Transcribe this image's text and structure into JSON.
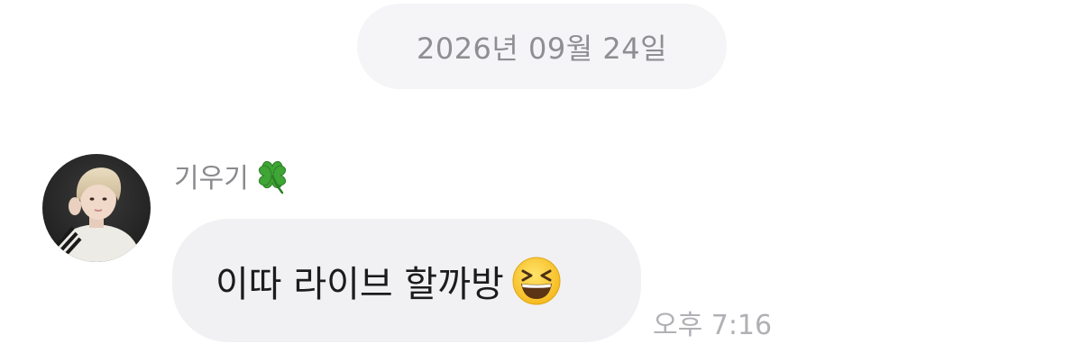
{
  "date_separator": {
    "label": "2026년 09월 24일"
  },
  "message": {
    "sender_name": "기우기",
    "sender_emoji_icon": "four-leaf-clover-icon",
    "text": "이따 라이브 할까방",
    "text_emoji_icon": "grinning-squinting-face-icon",
    "timestamp": "오후 7:16"
  },
  "colors": {
    "background": "#ffffff",
    "date_pill_bg": "#f5f5f7",
    "bubble_bg": "#f1f1f3",
    "secondary_text": "#8a8a8e",
    "timestamp_text": "#b0b0b5",
    "message_text": "#1c1c1e"
  }
}
